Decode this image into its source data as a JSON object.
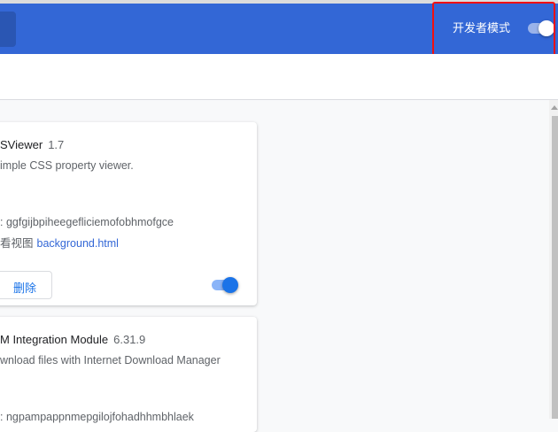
{
  "header": {
    "dev_mode_label": "开发者模式",
    "dev_mode_on": true
  },
  "extensions": [
    {
      "name": "SViewer",
      "version": "1.7",
      "description": "imple CSS property viewer.",
      "id_label": ":",
      "id": "ggfgijbpiheegefliciemofobhmofgce",
      "views_label": "看视图",
      "view_link": "background.html",
      "remove_label": "删除",
      "enabled": true
    },
    {
      "name": "M Integration Module",
      "version": "6.31.9",
      "description": "wnload files with Internet Download Manager",
      "id_label": ":",
      "id": "ngpampappnmepgilojfohadhhmbhlaek"
    }
  ],
  "colors": {
    "header": "#3367d6",
    "accent": "#1a73e8",
    "highlight": "#f01010"
  }
}
